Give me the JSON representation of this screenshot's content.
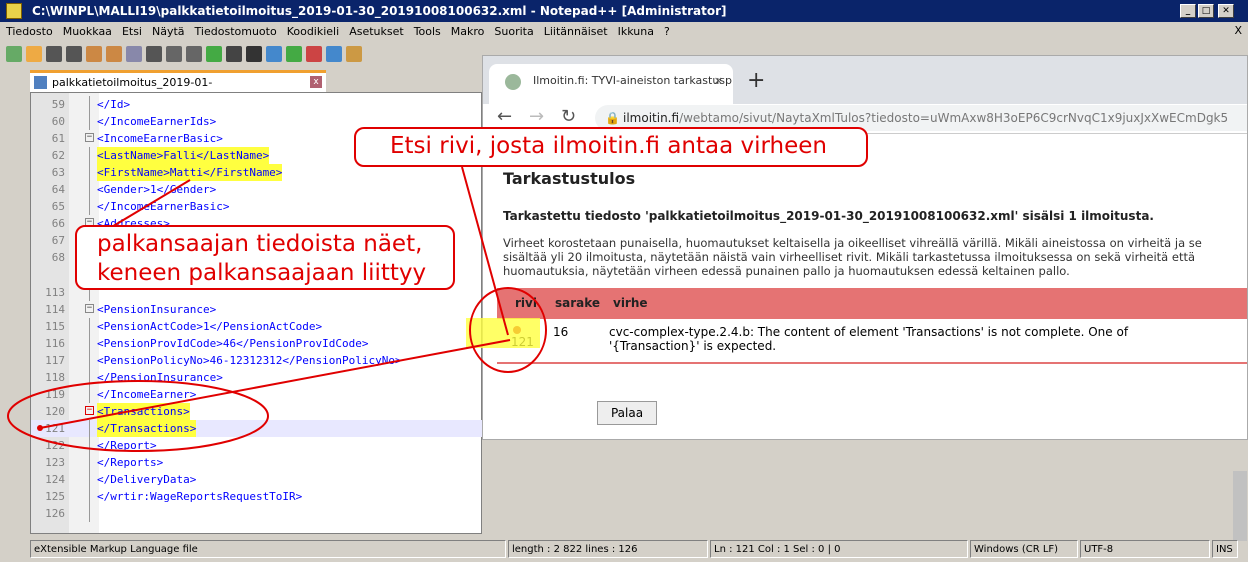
{
  "window": {
    "title": "C:\\WINPL\\MALLI19\\palkkatietoilmoitus_2019-01-30_20191008100632.xml - Notepad++ [Administrator]",
    "close_x": "X"
  },
  "menu": [
    "Tiedosto",
    "Muokkaa",
    "Etsi",
    "Näytä",
    "Tiedostomuoto",
    "Koodikieli",
    "Asetukset",
    "Tools",
    "Makro",
    "Suorita",
    "Liitännäiset",
    "Ikkuna",
    "?"
  ],
  "editor": {
    "tab": "palkkatietoilmoitus_2019-01-30_20191008100632.xml",
    "lines_top": [
      {
        "n": "59",
        "t": "</Id>",
        "ind": 1
      },
      {
        "n": "60",
        "t": "</IncomeEarnerIds>",
        "ind": 1
      },
      {
        "n": "61",
        "t": "<IncomeEarnerBasic>",
        "ind": 0,
        "fold": "minus"
      },
      {
        "n": "62",
        "t": "<LastName>Falli</LastName>",
        "ind": 1,
        "hl": true
      },
      {
        "n": "63",
        "t": "<FirstName>Matti</FirstName>",
        "ind": 1,
        "hl": true
      },
      {
        "n": "64",
        "t": "<Gender>1</Gender>",
        "ind": 1
      },
      {
        "n": "65",
        "t": "</IncomeEarnerBasic>",
        "ind": 1
      },
      {
        "n": "66",
        "t": "<Addresses>",
        "ind": 0,
        "fold": "minus"
      },
      {
        "n": "67",
        "t": "",
        "ind": 1
      },
      {
        "n": "68",
        "t": "",
        "ind": 1
      }
    ],
    "lines_bottom": [
      {
        "n": "113",
        "t": "",
        "ind": 1
      },
      {
        "n": "114",
        "t": "<PensionInsurance>",
        "ind": 0,
        "fold": "minus"
      },
      {
        "n": "115",
        "t": "<PensionActCode>1</PensionActCode>",
        "ind": 1
      },
      {
        "n": "116",
        "t": "<PensionProvIdCode>46</PensionProvIdCode>",
        "ind": 1
      },
      {
        "n": "117",
        "t": "<PensionPolicyNo>46-12312312</PensionPolicyNo>",
        "ind": 1
      },
      {
        "n": "118",
        "t": "</PensionInsurance>",
        "ind": 1
      },
      {
        "n": "119",
        "t": "</IncomeEarner>",
        "ind": 1
      },
      {
        "n": "120",
        "t": "<Transactions>",
        "ind": 0,
        "fold": "minus-red",
        "hl": true
      },
      {
        "n": "121",
        "t": "</Transactions>",
        "ind": 1,
        "hl": true,
        "cur": true
      },
      {
        "n": "122",
        "t": "</Report>",
        "ind": 1
      },
      {
        "n": "123",
        "t": "</Reports>",
        "ind": 1
      },
      {
        "n": "124",
        "t": "</DeliveryData>",
        "ind": 1
      },
      {
        "n": "125",
        "t": "</wrtir:WageReportsRequestToIR>",
        "ind": 1
      },
      {
        "n": "126",
        "t": "",
        "ind": 2
      }
    ]
  },
  "browser": {
    "tab_title": "Ilmoitin.fi: TYVI-aineiston tarkastusp",
    "tab_close": "×",
    "new_tab": "+",
    "url_domain": "ilmoitin.fi",
    "url_path": "/webtamo/sivut/NaytaXmlTulos?tiedosto=uWmAxw8H3oEP6C9crNvqC1x9juxJxXwECmDgk5",
    "heading": "Tarkastustulos",
    "summary": "Tarkastettu tiedosto 'palkkatietoilmoitus_2019-01-30_20191008100632.xml' sisälsi 1 ilmoitusta.",
    "info": "Virheet korostetaan punaisella, huomautukset keltaisella ja oikeelliset vihreällä värillä. Mikäli aineistossa on virheitä ja se sisältää yli 20 ilmoitusta, näytetään näistä vain virheelliset rivit. Mikäli tarkastetussa ilmoituksessa on sekä virheitä että huomautuksia, näytetään virheen edessä punainen pallo ja huomautuksen edessä keltainen pallo.",
    "columns": [
      "rivi",
      "sarake",
      "virhe"
    ],
    "rows": [
      {
        "rivi": "121",
        "sarake": "16",
        "virhe": "cvc-complex-type.2.4.b: The content of element 'Transactions' is not complete. One of '{Transaction}' is expected."
      }
    ],
    "back_button": "Palaa"
  },
  "callouts": {
    "top": "Etsi rivi, josta ilmoitin.fi antaa virheen",
    "left": "palkansaajan tiedoista näet, keneen palkansaajaan liittyy"
  },
  "status": {
    "type": "eXtensible Markup Language file",
    "length": "length : 2 822    lines : 126",
    "pos": "Ln : 121    Col : 1    Sel : 0 | 0",
    "eol": "Windows (CR LF)",
    "enc": "UTF-8",
    "mode": "INS"
  },
  "colors": {
    "annotation": "#e00000",
    "highlight": "#ffff40",
    "error_header": "#e57373",
    "titlebar": "#0a246a"
  }
}
